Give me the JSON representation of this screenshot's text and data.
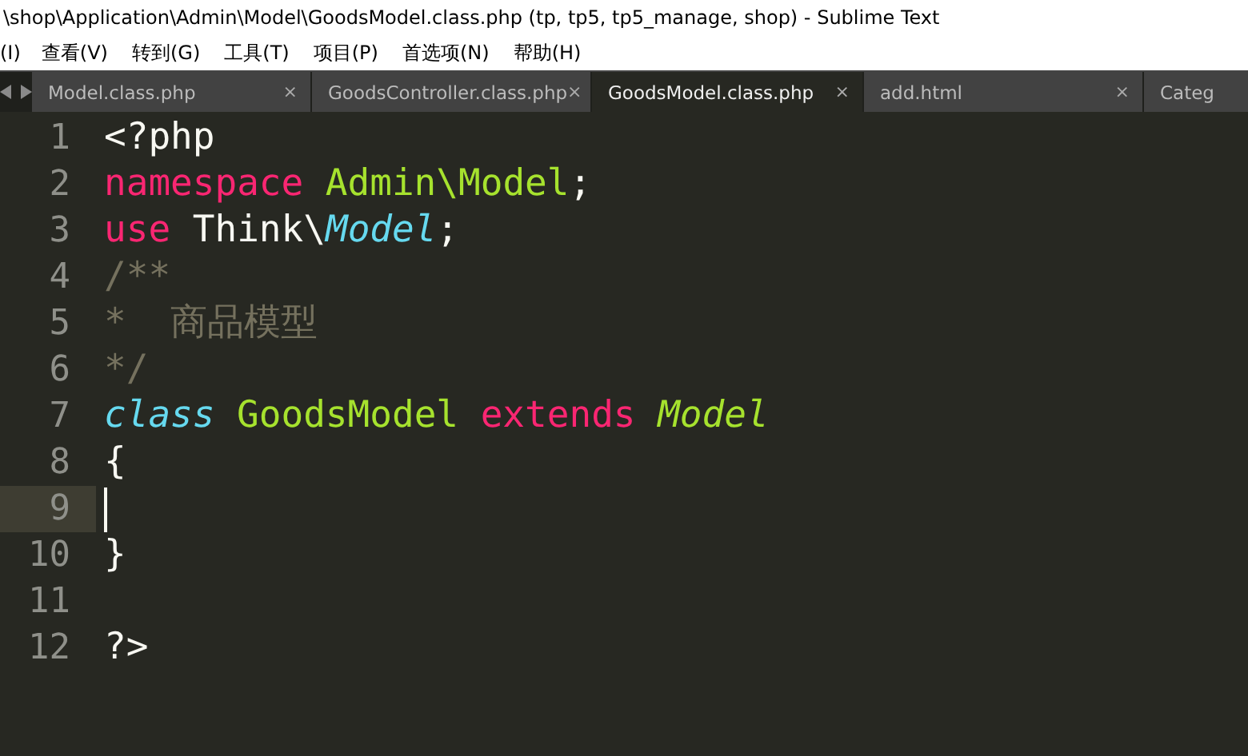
{
  "window": {
    "title": "\\shop\\Application\\Admin\\Model\\GoodsModel.class.php (tp, tp5, tp5_manage, shop) - Sublime Text"
  },
  "menu": [
    "(I)",
    "查看(V)",
    "转到(G)",
    "工具(T)",
    "项目(P)",
    "首选项(N)",
    "帮助(H)"
  ],
  "tabs": [
    {
      "label": "Model.class.php",
      "selected": false,
      "close": "×"
    },
    {
      "label": "GoodsController.class.php",
      "selected": false,
      "close": "×"
    },
    {
      "label": "GoodsModel.class.php",
      "selected": true,
      "close": "×"
    },
    {
      "label": "add.html",
      "selected": false,
      "close": "×"
    },
    {
      "label": "Categ",
      "selected": false
    }
  ],
  "editor": {
    "lines": [
      {
        "number": "1",
        "current": false,
        "tokens": [
          {
            "kind": "plain",
            "text": "<?php"
          }
        ]
      },
      {
        "number": "2",
        "current": false,
        "tokens": [
          {
            "kind": "keyword",
            "text": "namespace"
          },
          {
            "kind": "entity",
            "text": "Admin\\Model",
            "spaced": true
          },
          {
            "kind": "plain",
            "text": ";"
          }
        ]
      },
      {
        "number": "3",
        "current": false,
        "tokens": [
          {
            "kind": "keyword",
            "text": "use"
          },
          {
            "kind": "plain",
            "text": " Think\\"
          },
          {
            "kind": "type",
            "text": "Model"
          },
          {
            "kind": "plain",
            "text": ";"
          }
        ]
      },
      {
        "number": "4",
        "current": false,
        "tokens": [
          {
            "kind": "comment",
            "text": "/**"
          }
        ]
      },
      {
        "number": "5",
        "current": false,
        "tokens": [
          {
            "kind": "comment",
            "text": "*  商品模型"
          }
        ]
      },
      {
        "number": "6",
        "current": false,
        "tokens": [
          {
            "kind": "comment",
            "text": "*/"
          }
        ]
      },
      {
        "number": "7",
        "current": false,
        "tokens": [
          {
            "kind": "type",
            "text": "class"
          },
          {
            "kind": "entity",
            "text": "GoodsModel",
            "spaced": true
          },
          {
            "kind": "keyword",
            "text": "extends",
            "spaced": true
          },
          {
            "kind": "inherited",
            "text": "Model",
            "spaced": true
          }
        ]
      },
      {
        "number": "8",
        "current": false,
        "tokens": [
          {
            "kind": "plain",
            "text": "{"
          }
        ]
      },
      {
        "number": "9",
        "current": true
      },
      {
        "number": "10",
        "current": false,
        "tokens": [
          {
            "kind": "plain",
            "text": "}"
          }
        ]
      },
      {
        "number": "11",
        "current": false
      },
      {
        "number": "12",
        "current": false,
        "tokens": [
          {
            "kind": "plain",
            "text": "?>"
          }
        ]
      }
    ]
  }
}
